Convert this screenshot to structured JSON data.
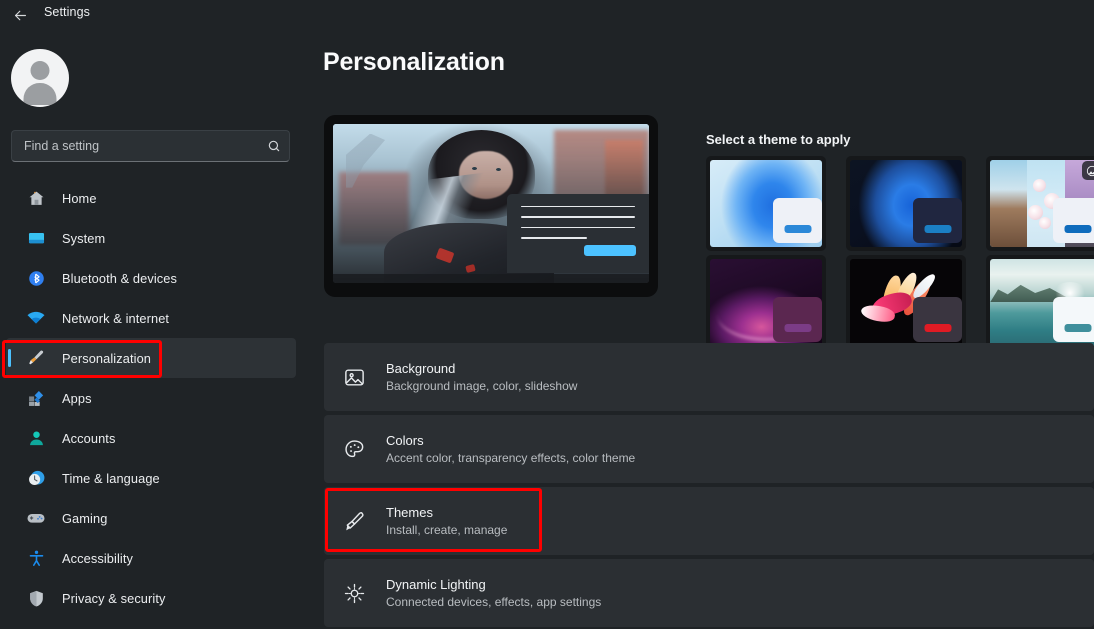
{
  "titlebar": {
    "back_icon": "back-arrow-icon",
    "title": "Settings"
  },
  "sidebar": {
    "avatar": "user-avatar",
    "search": {
      "value": "",
      "placeholder": "Find a setting",
      "icon": "search-icon"
    },
    "items": [
      {
        "label": "Home",
        "icon": "home-icon",
        "selected": false
      },
      {
        "label": "System",
        "icon": "system-icon",
        "selected": false
      },
      {
        "label": "Bluetooth & devices",
        "icon": "bluetooth-icon",
        "selected": false
      },
      {
        "label": "Network & internet",
        "icon": "wifi-icon",
        "selected": false
      },
      {
        "label": "Personalization",
        "icon": "paintbrush-icon",
        "selected": true
      },
      {
        "label": "Apps",
        "icon": "apps-icon",
        "selected": false
      },
      {
        "label": "Accounts",
        "icon": "accounts-icon",
        "selected": false
      },
      {
        "label": "Time & language",
        "icon": "clock-icon",
        "selected": false
      },
      {
        "label": "Gaming",
        "icon": "gamepad-icon",
        "selected": false
      },
      {
        "label": "Accessibility",
        "icon": "accessibility-icon",
        "selected": false
      },
      {
        "label": "Privacy & security",
        "icon": "shield-icon",
        "selected": false
      }
    ]
  },
  "main": {
    "page_title": "Personalization",
    "preview": {
      "name": "desktop-preview-monitor",
      "wallpaper": "cyberpunk-character-wallpaper",
      "accent_color": "#4cc2ff"
    },
    "themes": {
      "heading": "Select a theme to apply",
      "cards": [
        {
          "name": "theme-windows-light",
          "badge": "",
          "window": "light",
          "pill_color": "#2b88d8"
        },
        {
          "name": "theme-windows-dark",
          "badge": "",
          "window": "dark",
          "pill_color": "#1b7fc4"
        },
        {
          "name": "theme-captured-motion",
          "badge": "picture-badge-icon",
          "window": "light",
          "pill_color": "#0f6cbd"
        },
        {
          "name": "theme-glow",
          "badge": "",
          "window": "plum",
          "pill_color": "#7b3c86"
        },
        {
          "name": "theme-flow",
          "badge": "",
          "window": "charcoal",
          "pill_color": "#e01b24"
        },
        {
          "name": "theme-sunrise",
          "badge": "",
          "window": "frost",
          "pill_color": "#3f8f9c"
        }
      ]
    },
    "settings_rows": [
      {
        "icon": "picture-icon",
        "title": "Background",
        "subtitle": "Background image, color, slideshow",
        "highlighted": false
      },
      {
        "icon": "palette-icon",
        "title": "Colors",
        "subtitle": "Accent color, transparency effects, color theme",
        "highlighted": false
      },
      {
        "icon": "paintbrush-icon",
        "title": "Themes",
        "subtitle": "Install, create, manage",
        "highlighted": true
      },
      {
        "icon": "sparkle-icon",
        "title": "Dynamic Lighting",
        "subtitle": "Connected devices, effects, app settings",
        "highlighted": false
      }
    ]
  },
  "annotations": {
    "highlight_color": "#ff0000",
    "boxes": [
      {
        "name": "annotation-box-personalization",
        "target": "sidebar-item-personalization"
      },
      {
        "name": "annotation-box-themes",
        "target": "settings-row-themes"
      }
    ]
  }
}
